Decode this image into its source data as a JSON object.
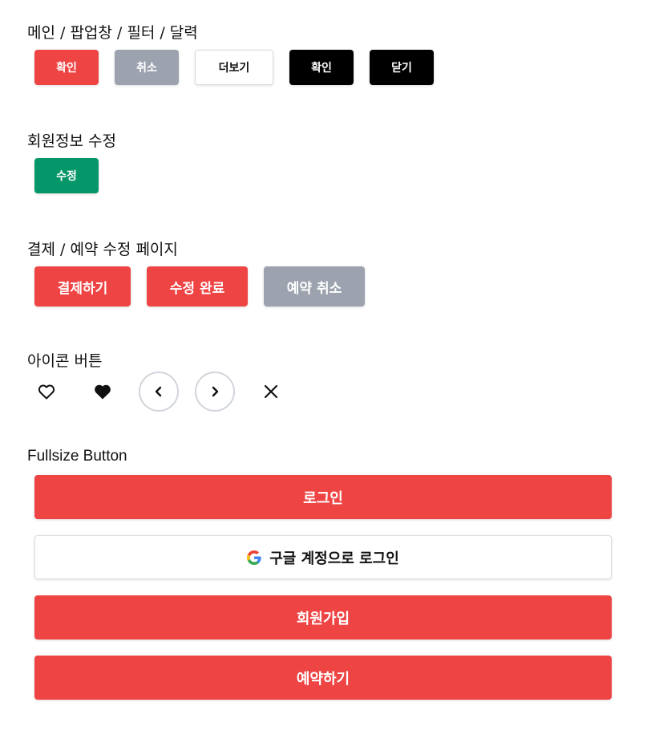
{
  "sections": {
    "main_popup": {
      "title": "메인 / 팝업창 / 필터 / 달력",
      "confirm": "확인",
      "cancel": "취소",
      "more": "더보기",
      "confirm_dark": "확인",
      "close": "닫기"
    },
    "member_edit": {
      "title": "회원정보 수정",
      "edit": "수정"
    },
    "payment": {
      "title": "결제 / 예약 수정 페이지",
      "pay": "결제하기",
      "edit_done": "수정 완료",
      "cancel_reservation": "예약 취소"
    },
    "icon_buttons": {
      "title": "아이콘 버튼",
      "icons": [
        "heart-outline-icon",
        "heart-filled-icon",
        "chevron-left-icon",
        "chevron-right-icon",
        "close-icon"
      ]
    },
    "fullsize": {
      "title": "Fullsize Button",
      "login": "로그인",
      "google_login": "구글 계정으로 로그인",
      "signup": "회원가입",
      "reserve": "예약하기"
    }
  },
  "colors": {
    "primary_red": "#ef4444",
    "gray": "#9ca3af",
    "black": "#000000",
    "green": "#059669",
    "white": "#ffffff"
  }
}
